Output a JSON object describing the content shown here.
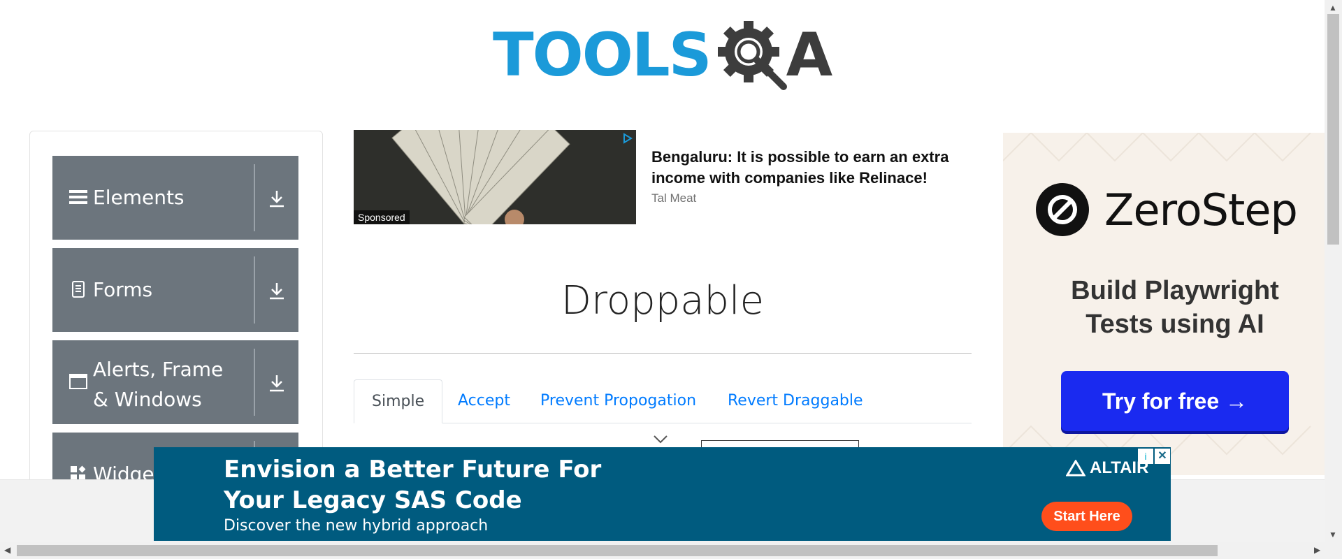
{
  "header": {
    "logo_left": "TOOLS",
    "logo_right": "A"
  },
  "sidebar": {
    "groups": [
      {
        "label": "Elements",
        "icon": "menu-icon"
      },
      {
        "label": "Forms",
        "icon": "document-icon"
      },
      {
        "label": "Alerts, Frame & Windows",
        "icon": "window-icon"
      },
      {
        "label": "Widgets",
        "icon": "widgets-icon"
      }
    ]
  },
  "sponsored": {
    "badge": "Sponsored",
    "headline": "Bengaluru: It is possible to earn an extra income with companies like Relinace!",
    "source": "Tal Meat"
  },
  "main": {
    "title": "Droppable",
    "tabs": [
      {
        "label": "Simple",
        "active": true
      },
      {
        "label": "Accept",
        "active": false
      },
      {
        "label": "Prevent Propogation",
        "active": false
      },
      {
        "label": "Revert Draggable",
        "active": false
      }
    ]
  },
  "right_ad": {
    "brand": "ZeroStep",
    "copy": "Build Playwright Tests using AI",
    "button": "Try for free →",
    "colors": {
      "button": "#1a2af0",
      "bg": "#f7f1ea"
    }
  },
  "bottom_banner": {
    "headline": "Envision a Better Future For Your Legacy SAS Code",
    "sub": "Discover the new hybrid approach",
    "brand": "ALTAIR",
    "cta": "Start Here",
    "colors": {
      "bg": "#005b7f",
      "cta": "#ff4e1b"
    }
  },
  "colors": {
    "sidebar_group": "#6c757d",
    "tab_link": "#007bff",
    "logo_blue": "#1b9ad9"
  }
}
